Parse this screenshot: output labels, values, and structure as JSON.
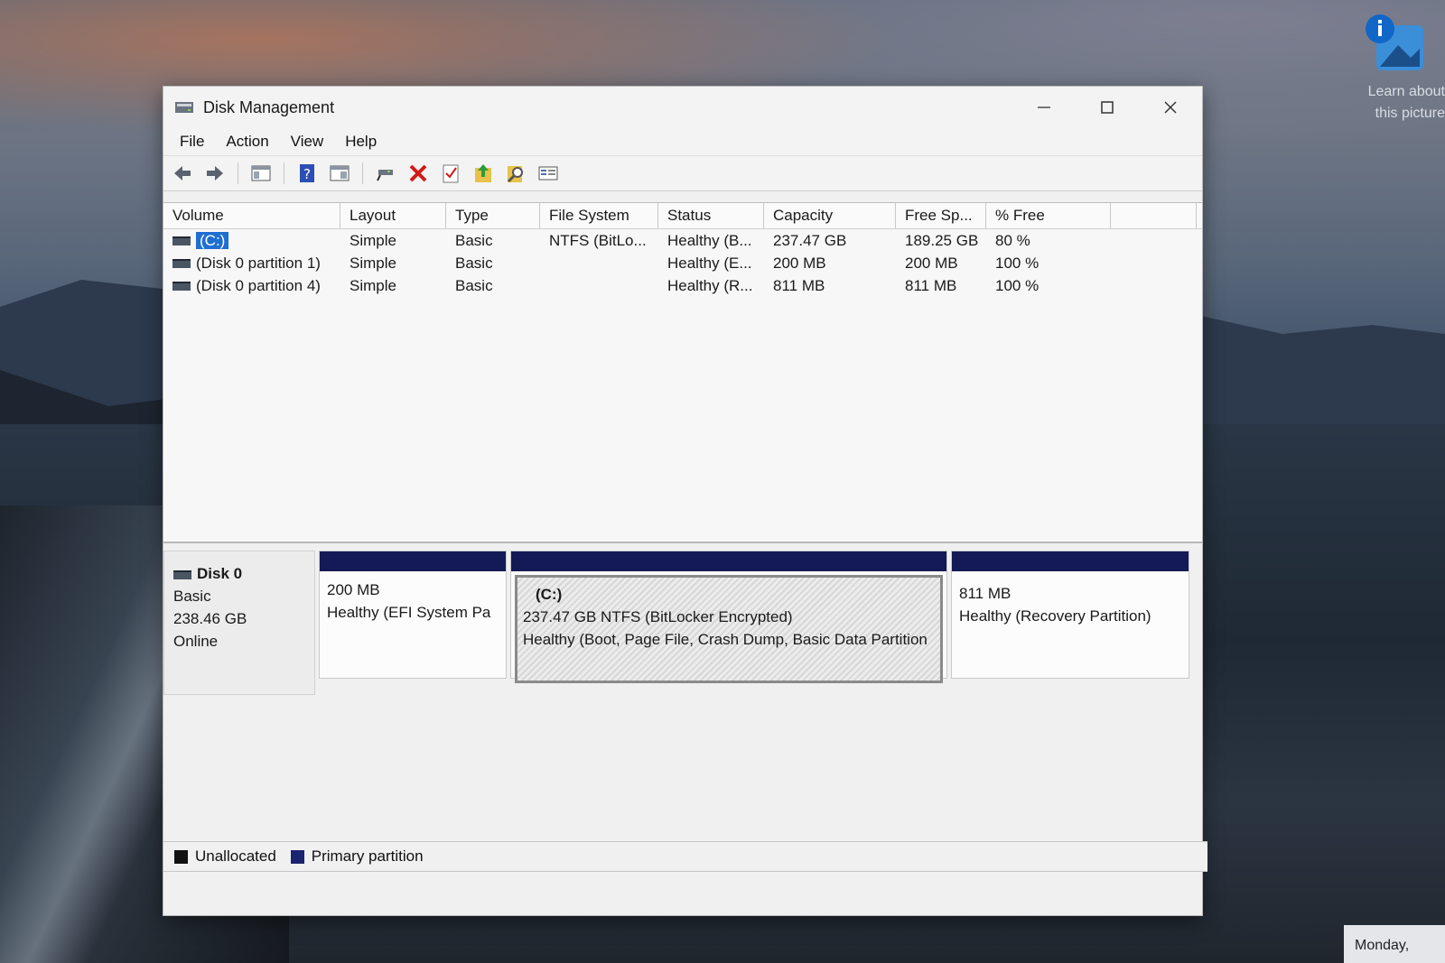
{
  "desktop": {
    "info_line1": "Learn about",
    "info_line2": "this picture",
    "clock": "Monday,"
  },
  "window": {
    "title": "Disk Management",
    "menu": [
      "File",
      "Action",
      "View",
      "Help"
    ],
    "toolbar_icons": [
      "back-icon",
      "forward-icon",
      "console-tree-icon",
      "help-icon",
      "properties-view-icon",
      "connect-icon",
      "delete-icon",
      "check-icon",
      "export-icon",
      "find-icon",
      "settings-icon"
    ]
  },
  "volume_list": {
    "columns": [
      "Volume",
      "Layout",
      "Type",
      "File System",
      "Status",
      "Capacity",
      "Free Sp...",
      "% Free"
    ],
    "rows": [
      {
        "volume": "(C:)",
        "layout": "Simple",
        "type": "Basic",
        "fs": "NTFS (BitLo...",
        "status": "Healthy (B...",
        "capacity": "237.47 GB",
        "free": "189.25 GB",
        "pct": "80 %"
      },
      {
        "volume": "(Disk 0 partition 1)",
        "layout": "Simple",
        "type": "Basic",
        "fs": "",
        "status": "Healthy (E...",
        "capacity": "200 MB",
        "free": "200 MB",
        "pct": "100 %"
      },
      {
        "volume": "(Disk 0 partition 4)",
        "layout": "Simple",
        "type": "Basic",
        "fs": "",
        "status": "Healthy (R...",
        "capacity": "811 MB",
        "free": "811 MB",
        "pct": "100 %"
      }
    ]
  },
  "disk": {
    "name": "Disk 0",
    "type": "Basic",
    "size": "238.46 GB",
    "state": "Online",
    "partitions": [
      {
        "label": "",
        "line1": "200 MB",
        "line2": "Healthy (EFI System Pa"
      },
      {
        "label": "(C:)",
        "line1": "237.47 GB NTFS (BitLocker Encrypted)",
        "line2": "Healthy (Boot, Page File, Crash Dump, Basic Data Partition"
      },
      {
        "label": "",
        "line1": "811 MB",
        "line2": "Healthy (Recovery Partition)"
      }
    ]
  },
  "legend": {
    "unallocated": "Unallocated",
    "primary": "Primary partition",
    "unallocated_color": "#111111",
    "primary_color": "#1a2470"
  }
}
